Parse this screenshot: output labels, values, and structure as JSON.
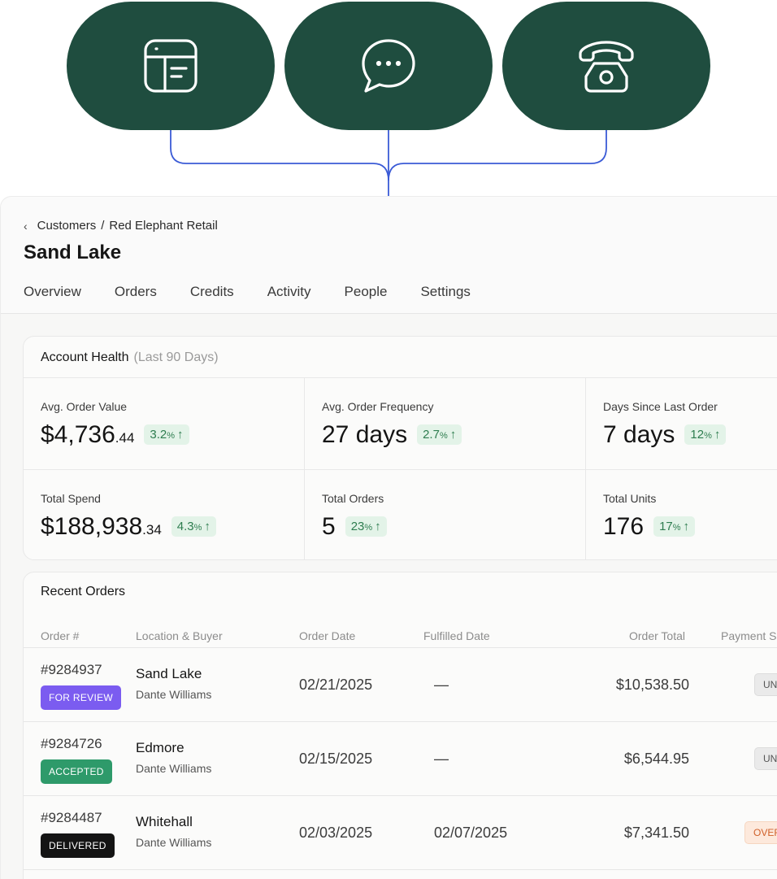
{
  "channels": [
    {
      "icon": "storefront-icon"
    },
    {
      "icon": "chat-bubble-icon"
    },
    {
      "icon": "telephone-icon"
    }
  ],
  "breadcrumb": {
    "parent": "Customers",
    "separator": "/",
    "current": "Red Elephant Retail"
  },
  "page": {
    "title": "Sand Lake"
  },
  "tabs": [
    {
      "label": "Overview"
    },
    {
      "label": "Orders"
    },
    {
      "label": "Credits"
    },
    {
      "label": "Activity"
    },
    {
      "label": "People"
    },
    {
      "label": "Settings"
    }
  ],
  "health": {
    "title": "Account Health",
    "period": "(Last 90 Days)",
    "metrics": [
      {
        "label": "Avg. Order Value",
        "value": "$4,736",
        "cents": ".44",
        "change": "3.2",
        "pct": "%",
        "arrow": "↑"
      },
      {
        "label": "Avg. Order Frequency",
        "value": "27 days",
        "cents": "",
        "change": "2.7",
        "pct": "%",
        "arrow": "↑"
      },
      {
        "label": "Days Since Last Order",
        "value": "7 days",
        "cents": "",
        "change": "12",
        "pct": "%",
        "arrow": "↑"
      },
      {
        "label": "Total Spend",
        "value": "$188,938",
        "cents": ".34",
        "change": "4.3",
        "pct": "%",
        "arrow": "↑"
      },
      {
        "label": "Total Orders",
        "value": "5",
        "cents": "",
        "change": "23",
        "pct": "%",
        "arrow": "↑"
      },
      {
        "label": "Total Units",
        "value": "176",
        "cents": "",
        "change": "17",
        "pct": "%",
        "arrow": "↑"
      }
    ]
  },
  "orders": {
    "title": "Recent Orders",
    "columns": [
      "Order #",
      "Location & Buyer",
      "Order Date",
      "Fulfilled Date",
      "Order Total",
      "Payment S"
    ],
    "rows": [
      {
        "order": "#9284937",
        "status": "FOR REVIEW",
        "status_color": "#7b5cf0",
        "location": "Sand Lake",
        "buyer": "Dante Williams",
        "order_date": "02/21/2025",
        "fulfilled": "—",
        "total": "$10,538.50",
        "payment": "UN"
      },
      {
        "order": "#9284726",
        "status": "ACCEPTED",
        "status_color": "#2e9a6a",
        "location": "Edmore",
        "buyer": "Dante Williams",
        "order_date": "02/15/2025",
        "fulfilled": "—",
        "total": "$6,544.95",
        "payment": "UN"
      },
      {
        "order": "#9284487",
        "status": "DELIVERED",
        "status_color": "#141414",
        "location": "Whitehall",
        "buyer": "Dante Williams",
        "order_date": "02/03/2025",
        "fulfilled": "02/07/2025",
        "total": "$7,341.50",
        "payment": "OVER"
      }
    ]
  },
  "colors": {
    "pill_green": "#1f4d3f",
    "connector_blue": "#3b5bd6",
    "change_green": "#2e7d4f"
  }
}
